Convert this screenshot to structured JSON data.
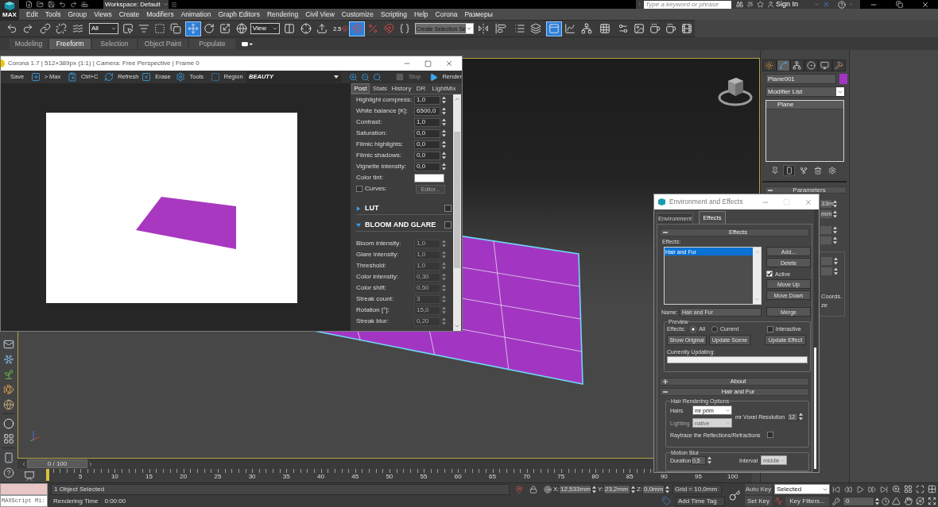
{
  "logo": {
    "label": "MAX"
  },
  "title_bar": {
    "workspace": "Workspace: Default",
    "search": {
      "placeholder": "Type a keyword or phrase"
    },
    "sign_in": "Sign In"
  },
  "menu": [
    "Edit",
    "Tools",
    "Group",
    "Views",
    "Create",
    "Modifiers",
    "Animation",
    "Graph Editors",
    "Rendering",
    "Civil View",
    "Customize",
    "Scripting",
    "Help",
    "Corona",
    "Размеры"
  ],
  "main_toolbar": {
    "selection_filter": "All",
    "reference_coordinate": "View",
    "snap_label": "2.5",
    "named_selection": "Create Selection Se",
    "tools": [
      {
        "selected": false
      },
      {
        "selected": false
      },
      {
        "selected": false
      },
      {
        "selected": false
      },
      {
        "selected": false
      },
      {
        "selected": false
      },
      {
        "selected": false
      },
      {
        "selected": false
      },
      {
        "selected": false
      },
      {
        "selected": true
      },
      {
        "selected": false
      },
      {
        "selected": false
      },
      {
        "selected": false
      },
      {
        "selected": false
      },
      {
        "selected": false
      },
      {
        "selected": false
      },
      {
        "selected": false
      },
      {
        "selected": true
      },
      {
        "selected": false
      },
      {
        "selected": false
      },
      {
        "selected": false
      },
      {
        "selected": false
      },
      {
        "selected": false
      },
      {
        "selected": false
      },
      {
        "selected": false
      },
      {
        "selected": true
      },
      {
        "selected": false
      },
      {
        "selected": false
      },
      {
        "selected": false
      },
      {
        "selected": false
      },
      {
        "selected": false
      },
      {
        "selected": false
      },
      {
        "selected": false
      },
      {
        "selected": false
      }
    ]
  },
  "ribbon_tabs": [
    {
      "label": "Modeling",
      "selected": false
    },
    {
      "label": "Freeform",
      "selected": true
    },
    {
      "label": "Selection",
      "selected": false
    },
    {
      "label": "Object Paint",
      "selected": false
    },
    {
      "label": "Populate",
      "selected": false
    }
  ],
  "timeline": {
    "slider": "0 / 100",
    "labels": [
      "5",
      "10",
      "15",
      "20",
      "25",
      "30",
      "35",
      "40",
      "45",
      "50",
      "55",
      "60",
      "65",
      "70",
      "75",
      "80",
      "85",
      "90",
      "95",
      "100"
    ]
  },
  "command_panel": {
    "tabs": [
      {
        "selected": false
      },
      {
        "selected": true
      },
      {
        "selected": false
      },
      {
        "selected": false
      },
      {
        "selected": false
      },
      {
        "selected": false
      }
    ],
    "object": {
      "name": "Plane001",
      "color": "#a236c2"
    },
    "modifier_list": "Modifier List",
    "stack": [
      {
        "label": "Plane"
      }
    ],
    "stack_tools": [
      {
        "selected": false
      },
      {
        "selected": true
      },
      {
        "selected": false
      },
      {
        "selected": false
      },
      {
        "selected": false
      }
    ],
    "rollout": {
      "title": "Parameters",
      "expanded": true
    },
    "parameter_values": [
      "33m",
      "mm"
    ],
    "group_labels": [
      "Coords.",
      "ze"
    ]
  },
  "corona_window": {
    "title": "Corona 1.7 | 512×389px (1:1) | Camera: Free Perspective | Frame 0",
    "toolbar": [
      "Save",
      "> Max",
      "Ctrl+C",
      "Refresh",
      "Erase",
      "Tools",
      "Region"
    ],
    "channel": "BEAUTY",
    "stop": {
      "label": "Stop",
      "disabled": true
    },
    "render": "Render",
    "tabs": [
      {
        "label": "Post",
        "selected": true
      },
      {
        "label": "Stats",
        "selected": false
      },
      {
        "label": "History",
        "selected": false
      },
      {
        "label": "DR",
        "selected": false
      },
      {
        "label": "LightMix",
        "selected": false
      }
    ],
    "post_rows": [
      {
        "kind": "spinner",
        "label": "Highlight compress:",
        "value": "1,0"
      },
      {
        "kind": "spinner",
        "label": "White balance [K]:",
        "value": "6500,0"
      },
      {
        "kind": "spinner",
        "label": "Contrast:",
        "value": "1,0"
      },
      {
        "kind": "spinner",
        "label": "Saturation:",
        "value": "0,0"
      },
      {
        "kind": "spinner",
        "label": "Filmic highlights:",
        "value": "0,0"
      },
      {
        "kind": "spinner",
        "label": "Filmic shadows:",
        "value": "0,0"
      },
      {
        "kind": "spinner",
        "label": "Vignette intensity:",
        "value": "0,0"
      },
      {
        "kind": "color",
        "label": "Color tint:",
        "color": "#ffffff"
      },
      {
        "kind": "checkbox",
        "label": "Curves:",
        "checked": false,
        "button": "Editor...",
        "disabled": true
      }
    ],
    "sections": [
      {
        "title": "LUT",
        "expanded": false,
        "checked": false
      },
      {
        "title": "BLOOM AND GLARE",
        "expanded": true,
        "checked": false,
        "rows": [
          {
            "label": "Bloom intensity:",
            "value": "1,0"
          },
          {
            "label": "Glare intensity:",
            "value": "1,0"
          },
          {
            "label": "Threshold:",
            "value": "1,0"
          },
          {
            "label": "Color intensity:",
            "value": "0,30"
          },
          {
            "label": "Color shift:",
            "value": "0,50"
          },
          {
            "label": "Streak count:",
            "value": "3"
          },
          {
            "label": "Rotation [°]:",
            "value": "15,0"
          },
          {
            "label": "Streak blur:",
            "value": "0,20"
          }
        ]
      }
    ]
  },
  "environment_dialog": {
    "title": "Environment and Effects",
    "tabs": [
      {
        "label": "Environment",
        "selected": false
      },
      {
        "label": "Effects",
        "selected": true
      }
    ],
    "effects_rollout": {
      "title": "Effects",
      "expanded": true,
      "list_label": "Effects:",
      "effects": [
        {
          "label": "Hair and Fur",
          "selected": true
        }
      ],
      "buttons": [
        "Add...",
        "Delete"
      ],
      "active": {
        "label": "Active",
        "checked": true
      },
      "move_buttons": [
        "Move Up",
        "Move Down"
      ],
      "name_label": "Name:",
      "name_value": "Hair and Fur",
      "merge": "Merge",
      "preview": {
        "title": "Preview",
        "effects_label": "Effects:",
        "radios": [
          {
            "label": "All",
            "selected": true
          },
          {
            "label": "Current",
            "selected": false
          }
        ],
        "interactive": {
          "label": "Interactive",
          "checked": false
        },
        "buttons": [
          "Show Original",
          "Update Scene",
          "Update Effect"
        ],
        "updating_label": "Currently Updating:"
      }
    },
    "about_rollout": {
      "title": "About",
      "expanded": false
    },
    "hair_rollout": {
      "title": "Hair and Fur",
      "expanded": true,
      "rendering_group": "Hair Rendering Options",
      "hairs": {
        "label": "Hairs",
        "value": "mr prim"
      },
      "voxel": {
        "label": "mr Voxel Resolution",
        "value": "12"
      },
      "lighting": {
        "label": "Lighting",
        "value": "native",
        "disabled": true
      },
      "raytrace": {
        "label": "Raytrace the Reflections/Refractions",
        "checked": false
      },
      "motion_group": "Motion Blur",
      "duration": {
        "label": "Duration",
        "value": "0,5"
      },
      "interval": {
        "label": "Interval",
        "value": "middle",
        "disabled": true
      }
    }
  },
  "status_bar": {
    "maxscript": "MAXScript Mi:",
    "selection": "1 Object Selected",
    "render_time_label": "Rendering Time",
    "render_time": "0:00:00",
    "coords": [
      {
        "axis": "X:",
        "value": "12,533mm"
      },
      {
        "axis": "Y:",
        "value": "23,2mm"
      },
      {
        "axis": "Z:",
        "value": "0,0mm"
      }
    ],
    "grid": "Grid = 10,0mm",
    "time_tag": "Add Time Tag",
    "auto_key": {
      "label": "Auto Key",
      "on": false
    },
    "set_key": "Set Key",
    "key_set": "Selected",
    "key_filters": "Key Filters...",
    "frame": "0"
  }
}
